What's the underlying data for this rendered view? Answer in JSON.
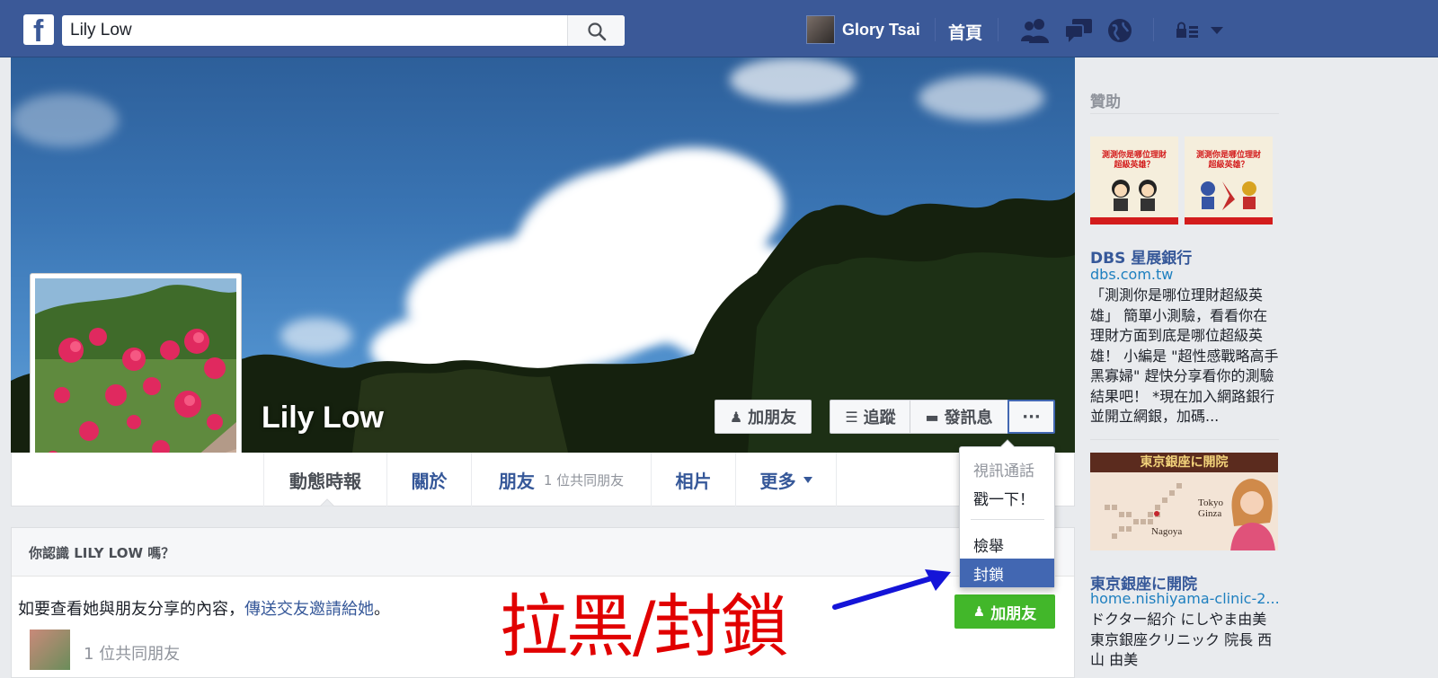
{
  "topbar": {
    "search_value": "Lily Low",
    "user_name": "Glory Tsai",
    "home_label": "首頁",
    "brand_color": "#3b5998"
  },
  "profile": {
    "name": "Lily Low",
    "buttons": {
      "add_friend": "加朋友",
      "follow": "追蹤",
      "message": "發訊息",
      "more": "···"
    },
    "tabs": {
      "timeline": "動態時報",
      "about": "關於",
      "friends": "朋友",
      "friends_sub": "1 位共同朋友",
      "photos": "相片",
      "more": "更多"
    }
  },
  "dropdown": {
    "items": [
      "視訊通話",
      "戳一下！",
      "檢舉",
      "封鎖"
    ],
    "highlighted": "封鎖"
  },
  "card": {
    "title": "你認識 LILY LOW 嗎？",
    "text_before": "如要查看她與朋友分享的內容，",
    "link": "傳送交友邀請給她",
    "text_after": "。",
    "mutual": "1 位共同朋友",
    "add_friend": "加朋友"
  },
  "annotation": {
    "text": "拉黑/封鎖",
    "color": "#e10000"
  },
  "sidebar": {
    "title": "贊助",
    "ads": [
      {
        "title": "DBS 星展銀行",
        "url": "dbs.com.tw",
        "body": "「測測你是哪位理財超級英雄」 簡單小測驗，看看你在理財方面到底是哪位超級英雄！ 小編是 \"超性感戰略高手黑寡婦\" 趕快分享看你的測驗結果吧！ *現在加入網路銀行並開立網銀，加碼...",
        "image_text": "測測你是哪位理財超級英雄？"
      },
      {
        "title": "東京銀座に開院",
        "url": "home.nishiyama-clinic-2....",
        "body": "ドクター紹介 にしやま由美 東京銀座クリニック 院長 西山 由美",
        "image_banner": "東京銀座に開院",
        "image_labels": [
          "Tokyo Ginza",
          "Nagoya"
        ]
      }
    ]
  }
}
